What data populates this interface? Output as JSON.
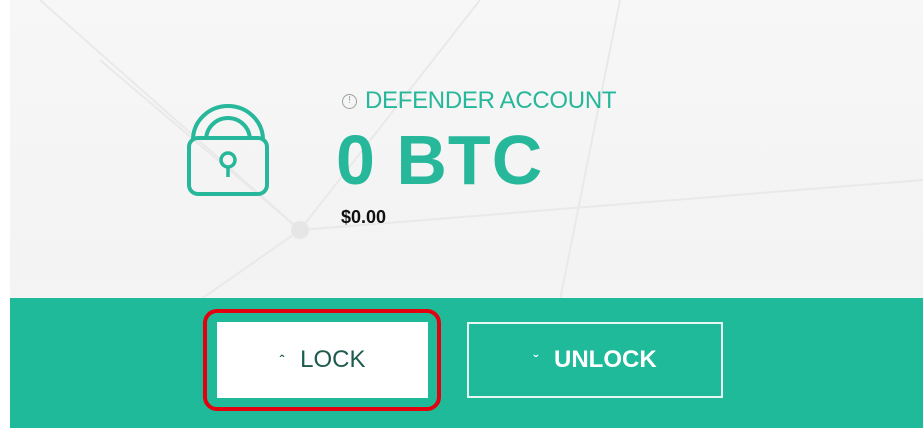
{
  "account": {
    "label": "DEFENDER ACCOUNT",
    "btc_amount": "0 BTC",
    "usd_amount": "$0.00"
  },
  "icons": {
    "info": "info-icon",
    "lock": "padlock-icon",
    "lock_button": "double-chevron-up-icon",
    "unlock_button": "double-chevron-down-icon"
  },
  "buttons": {
    "lock_label": "LOCK",
    "unlock_label": "UNLOCK"
  },
  "colors": {
    "accent": "#27b79a",
    "bar": "#1fba99",
    "highlight": "#e3000f"
  }
}
